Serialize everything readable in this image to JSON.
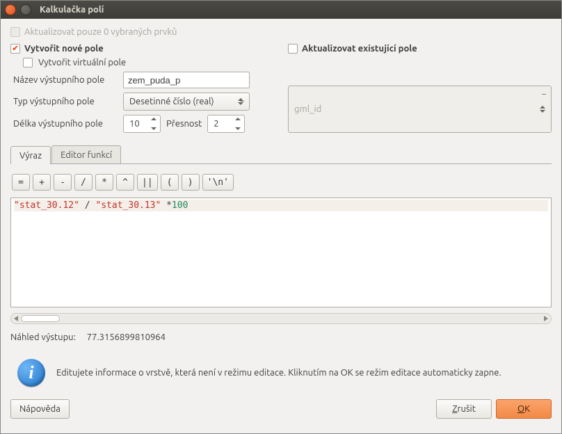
{
  "titlebar": {
    "title": "Kalkulačka polí"
  },
  "top": {
    "update_selected_label": "Aktualizovat pouze 0 vybraných prvků"
  },
  "left": {
    "create_field_label": "Vytvořit nové pole",
    "virtual_label": "Vytvořit virtuální pole",
    "name_label": "Název výstupního pole",
    "name_value": "zem_puda_p",
    "type_label": "Typ výstupního pole",
    "type_value": "Desetinné číslo (real)",
    "length_label": "Délka výstupního pole",
    "length_value": "10",
    "precision_label": "Přesnost",
    "precision_value": "2"
  },
  "right": {
    "update_existing_label": "Aktualizovat existující pole",
    "existing_field_value": "gml_id"
  },
  "tabs": {
    "expression": "Výraz",
    "editor": "Editor funkcí"
  },
  "ops": {
    "eq": "=",
    "plus": "+",
    "minus": "-",
    "div": "/",
    "mul": "*",
    "pow": "^",
    "concat": "||",
    "lparen": "(",
    "rparen": ")",
    "nl": "'\\n'"
  },
  "expression": {
    "part1": "\"stat_30.12\"",
    "opdiv": " / ",
    "part2": "\"stat_30.13\"",
    "opmul": " *",
    "num": "100"
  },
  "preview": {
    "label": "Náhled výstupu:",
    "value": "77.3156899810964"
  },
  "info": {
    "text": "Editujete informace o vrstvě, která není v režimu editace. Kliknutím na OK se režim editace automaticky zapne."
  },
  "buttons": {
    "help": "Nápověda",
    "cancel_pre": "",
    "cancel_u": "Z",
    "cancel_post": "rušit",
    "ok_pre": "",
    "ok_u": "O",
    "ok_post": "K"
  }
}
